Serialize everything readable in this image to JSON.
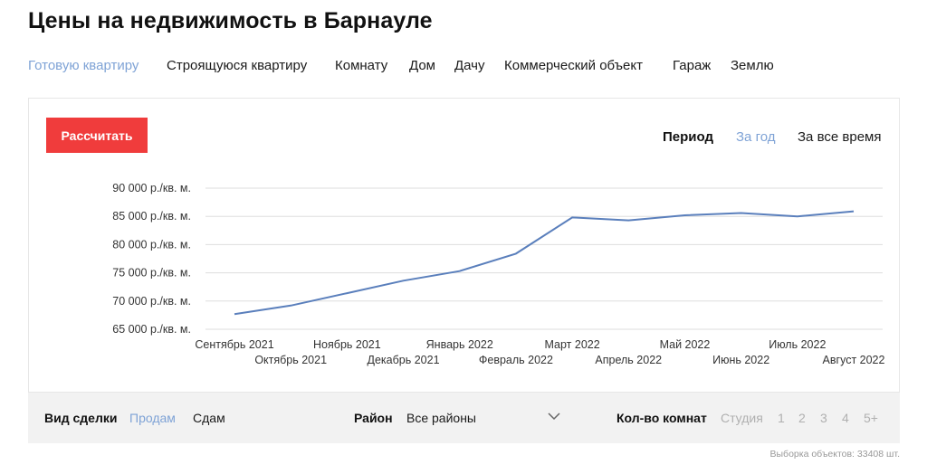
{
  "page": {
    "title": "Цены на недвижимость в Барнауле"
  },
  "property_types": [
    {
      "label": "Готовую квартиру",
      "active": true
    },
    {
      "label": "Строящуюся квартиру",
      "active": false
    },
    {
      "label": "Комнату",
      "active": false
    },
    {
      "label": "Дом",
      "active": false
    },
    {
      "label": "Дачу",
      "active": false
    },
    {
      "label": "Коммерческий объект",
      "active": false
    },
    {
      "label": "Гараж",
      "active": false
    },
    {
      "label": "Землю",
      "active": false
    }
  ],
  "calculate_button": {
    "label": "Рассчитать",
    "color": "#f03c3c"
  },
  "period": {
    "label": "Период",
    "options": [
      {
        "label": "За год",
        "active": true
      },
      {
        "label": "За все время",
        "active": false
      }
    ]
  },
  "chart_data": {
    "type": "line",
    "y_tick_labels": [
      "90 000 р./кв. м.",
      "85 000 р./кв. м.",
      "80 000 р./кв. м.",
      "75 000 р./кв. м.",
      "70 000 р./кв. м.",
      "65 000 р./кв. м."
    ],
    "y_ticks": [
      90000,
      85000,
      80000,
      75000,
      70000,
      65000
    ],
    "ylim": [
      65000,
      90000
    ],
    "categories": [
      "Сентябрь 2021",
      "Октябрь 2021",
      "Ноябрь 2021",
      "Декабрь 2021",
      "Январь 2022",
      "Февраль 2022",
      "Март 2022",
      "Апрель 2022",
      "Май 2022",
      "Июнь 2022",
      "Июль 2022",
      "Август 2022"
    ],
    "series": [
      {
        "values": [
          67700,
          69200,
          71400,
          73600,
          75300,
          78400,
          84800,
          84300,
          85200,
          85600,
          85000,
          85900
        ]
      }
    ],
    "grid": true,
    "legend": "none",
    "line_color": "#5a7fbc"
  },
  "filters": {
    "deal_type": {
      "label": "Вид сделки",
      "options": [
        {
          "label": "Продам",
          "active": true
        },
        {
          "label": "Сдам",
          "active": false
        }
      ]
    },
    "district": {
      "label": "Район",
      "value": "Все районы"
    },
    "rooms": {
      "label": "Кол-во комнат",
      "options": [
        "Студия",
        "1",
        "2",
        "3",
        "4",
        "5+"
      ]
    }
  },
  "sample_count": "Выборка объектов: 33408 шт."
}
